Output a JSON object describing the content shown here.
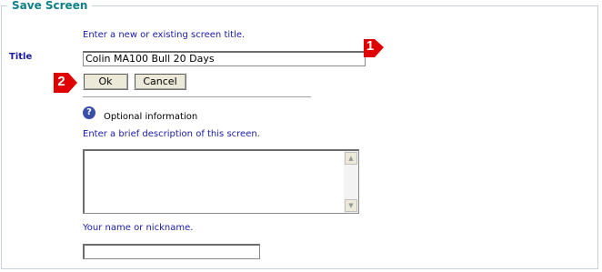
{
  "panel": {
    "legend": "Save Screen"
  },
  "title_section": {
    "hint": "Enter a new or existing screen title.",
    "label": "Title",
    "value": "Colin MA100 Bull 20 Days"
  },
  "buttons": {
    "ok_label": "Ok",
    "cancel_label": "Cancel"
  },
  "optional": {
    "icon": "help-icon",
    "icon_glyph": "?",
    "label": "Optional information",
    "description_hint": "Enter a brief description of this screen.",
    "description_value": "",
    "name_hint": "Your name or nickname.",
    "name_value": ""
  },
  "markers": {
    "one": "1",
    "two": "2",
    "color": "#e00000"
  },
  "colors": {
    "legend": "#0e7f88",
    "hint_text": "#1a1aa6",
    "button_face": "#ece9d8"
  }
}
